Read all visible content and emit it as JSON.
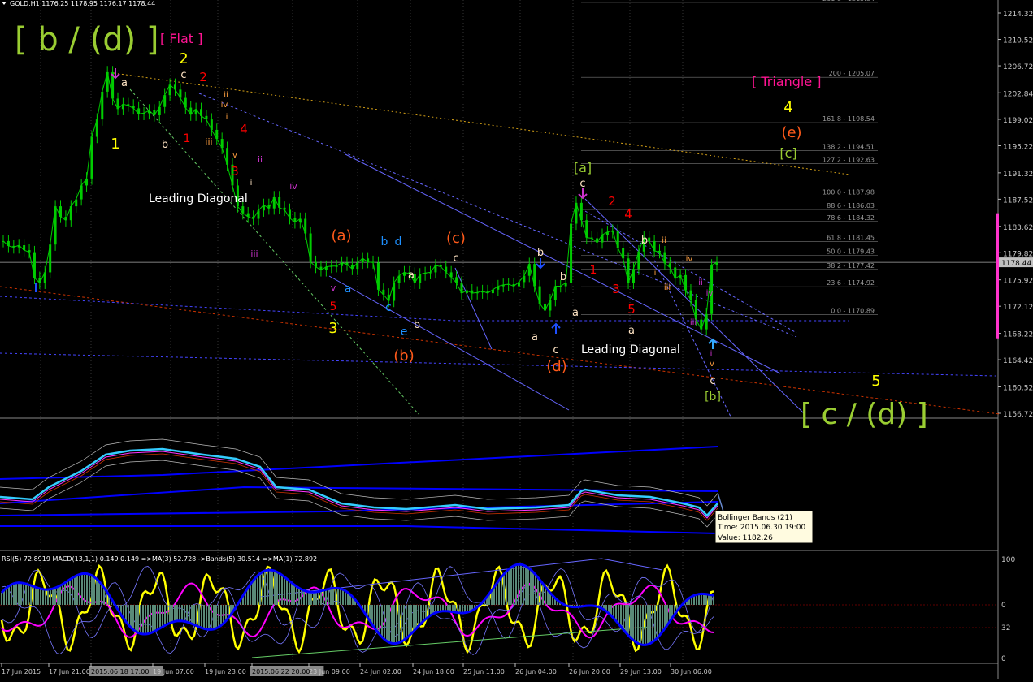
{
  "window": {
    "title": "GOLD,H1",
    "ohlc": [
      "1176.25",
      "1178.95",
      "1176.17",
      "1178.44"
    ]
  },
  "colors": {
    "background": "#000000",
    "candle": "#00cc00",
    "grid": "#2a2a2a",
    "axis_text": "#c8c8c8",
    "wave_yellow": "#ffff00",
    "wave_red": "#ff0000",
    "wave_orange": "#ff5a1a",
    "wave_green": "#9acd32",
    "wave_blue": "#1e90ff",
    "wave_purple": "#cc33cc",
    "wave_pink": "#ff1493",
    "wave_peach": "#ffe4c4",
    "wave_lightorange": "#ff9f40",
    "bb_cyan": "#33ccff",
    "bb_blue": "#0000ff",
    "rsi_yellow": "#ffff00",
    "ma_magenta": "#ff00ff",
    "macd_hist": "#5a8a78",
    "current_price_bg": "#c0c0c0"
  },
  "chart_data": [
    {
      "type": "line",
      "title": "GOLD,H1",
      "series": [
        {
          "values": [
            1181.5,
            1180.8,
            1180.6,
            1180.9,
            1180.2,
            1179.9,
            1176.2,
            1175.5,
            1177.0,
            1181.0,
            1186.5,
            1185.0,
            1184.5,
            1186.5,
            1187.5,
            1189.5,
            1190.5,
            1196.5,
            1199.0,
            1203.0,
            1205.8,
            1202.0,
            1200.5,
            1201.2,
            1201.0,
            1200.6,
            1199.8,
            1199.9,
            1200.3,
            1199.6,
            1200.8,
            1202.5,
            1204.0,
            1203.3,
            1202.1,
            1200.7,
            1199.7,
            1200.5,
            1199.5,
            1199.0,
            1197.5,
            1196.2,
            1194.9,
            1192.5,
            1189.5,
            1186.5,
            1185.5,
            1185.0,
            1184.7,
            1185.9,
            1186.7,
            1186.2,
            1187.8,
            1186.3,
            1186.0,
            1184.8,
            1184.2,
            1184.7,
            1182.6,
            1178.5,
            1177.8,
            1177.3,
            1177.8,
            1177.9,
            1177.9,
            1178.4,
            1178.1,
            1177.5,
            1178.4,
            1179.0,
            1178.5,
            1178.4,
            1174.5,
            1173.8,
            1172.9,
            1175.5,
            1176.5,
            1177.0,
            1176.8,
            1175.5,
            1176.7,
            1176.9,
            1177.0,
            1178.0,
            1177.8,
            1177.0,
            1176.3,
            1175.5,
            1174.0,
            1174.4,
            1174.0,
            1174.1,
            1174.3,
            1174.0,
            1174.5,
            1175.0,
            1175.2,
            1175.3,
            1175.0,
            1175.6,
            1176.5,
            1178.2,
            1175.0,
            1172.5,
            1171.5,
            1173.0,
            1175.0,
            1175.0,
            1175.5,
            1184.0,
            1187.0,
            1184.5,
            1182.0,
            1181.9,
            1181.3,
            1182.4,
            1182.8,
            1183.0,
            1180.5,
            1179.0,
            1175.5,
            1177.5,
            1180.0,
            1182.0,
            1181.5,
            1180.1,
            1179.9,
            1178.3,
            1177.7,
            1176.1,
            1176.6,
            1174.4,
            1173.0,
            1170.2,
            1168.8,
            1171.0,
            1178.0,
            1178.44
          ]
        }
      ],
      "x_tick_labels": [
        "17 Jun 2015",
        "17 Jun 21:00",
        "2015.06.18 17:00",
        "19 Jun 07:00",
        "19 Jun 23:00",
        "2015.06.22 20:00",
        "23 Jun 09:00",
        "24 Jun 02:00",
        "24 Jun 18:00",
        "25 Jun 11:00",
        "26 Jun 04:00",
        "26 Jun 20:00",
        "29 Jun 13:00",
        "30 Jun 06:00"
      ],
      "y_tick_labels": [
        "1214.32",
        "1210.52",
        "1206.72",
        "1202.84",
        "1199.02",
        "1195.22",
        "1191.32",
        "1187.52",
        "1183.62",
        "1179.82",
        "1175.92",
        "1172.12",
        "1168.22",
        "1164.42",
        "1160.52",
        "1156.72"
      ],
      "ylim": [
        1156.72,
        1214.32
      ],
      "current_price": "1178.44",
      "fibonacci_levels": [
        "261.8 - 1215.84",
        "200 - 1205.07",
        "161.8 - 1198.54",
        "138.2 - 1194.51",
        "127.2 - 1192.63",
        "100.0 - 1187.98",
        "88.6 - 1186.03",
        "78.6 - 1184.32",
        "61.8 - 1181.45",
        "50.0 - 1179.43",
        "38.2 - 1177.42",
        "23.6 - 1174.92",
        "0.0 - 1170.89"
      ],
      "wave_labels": {
        "big_label": "[ b / (d) ]",
        "flat_label": "[ Flat ]",
        "triangle_label": "[ Triangle ]",
        "c_d_label": "[ c / (d) ]",
        "leading_diagonal_1": "Leading Diagonal",
        "leading_diagonal_2": "Leading Diagonal",
        "labels": [
          {
            "text": "1",
            "color": "wave_yellow"
          },
          {
            "text": "2",
            "color": "wave_yellow"
          },
          {
            "text": "3",
            "color": "wave_yellow"
          },
          {
            "text": "4",
            "color": "wave_yellow"
          },
          {
            "text": "5",
            "color": "wave_yellow"
          },
          {
            "text": "a",
            "color": "wave_peach"
          },
          {
            "text": "c",
            "color": "wave_peach"
          },
          {
            "text": "b",
            "color": "wave_peach"
          },
          {
            "text": "2",
            "color": "wave_red"
          },
          {
            "text": "1",
            "color": "wave_red"
          },
          {
            "text": "3",
            "color": "wave_red"
          },
          {
            "text": "4",
            "color": "wave_red"
          },
          {
            "text": "5",
            "color": "wave_red"
          },
          {
            "text": "ii",
            "color": "wave_lightorange"
          },
          {
            "text": "iii",
            "color": "wave_lightorange"
          },
          {
            "text": "iv",
            "color": "wave_lightorange"
          },
          {
            "text": "v",
            "color": "wave_lightorange"
          },
          {
            "text": "i",
            "color": "wave_lightorange"
          },
          {
            "text": "ii",
            "color": "wave_purple"
          },
          {
            "text": "iv",
            "color": "wave_purple"
          },
          {
            "text": "iii",
            "color": "wave_purple"
          },
          {
            "text": "v",
            "color": "wave_purple"
          },
          {
            "text": "i",
            "color": "wave_peach"
          },
          {
            "text": "(a)",
            "color": "wave_orange"
          },
          {
            "text": "(b)",
            "color": "wave_orange"
          },
          {
            "text": "(c)",
            "color": "wave_orange"
          },
          {
            "text": "(d)",
            "color": "wave_orange"
          },
          {
            "text": "(e)",
            "color": "wave_orange"
          },
          {
            "text": "a",
            "color": "wave_blue"
          },
          {
            "text": "b",
            "color": "wave_blue"
          },
          {
            "text": "c",
            "color": "wave_blue"
          },
          {
            "text": "d",
            "color": "wave_blue"
          },
          {
            "text": "e",
            "color": "wave_blue"
          },
          {
            "text": "a",
            "color": "wave_peach"
          },
          {
            "text": "b",
            "color": "wave_peach"
          },
          {
            "text": "c",
            "color": "wave_peach"
          },
          {
            "text": "a",
            "color": "wave_peach"
          },
          {
            "text": "b",
            "color": "wave_peach"
          },
          {
            "text": "c",
            "color": "wave_peach"
          },
          {
            "text": "b",
            "color": "wave_peach"
          },
          {
            "text": "a",
            "color": "wave_peach"
          },
          {
            "text": "[a]",
            "color": "wave_green"
          },
          {
            "text": "c",
            "color": "wave_peach"
          },
          {
            "text": "[b]",
            "color": "wave_green"
          },
          {
            "text": "c",
            "color": "wave_peach"
          },
          {
            "text": "[c]",
            "color": "wave_green"
          },
          {
            "text": "b",
            "color": "wave_peach"
          },
          {
            "text": "a",
            "color": "wave_peach"
          },
          {
            "text": "1",
            "color": "wave_red"
          },
          {
            "text": "2",
            "color": "wave_red"
          },
          {
            "text": "3",
            "color": "wave_red"
          },
          {
            "text": "4",
            "color": "wave_red"
          },
          {
            "text": "5",
            "color": "wave_red"
          },
          {
            "text": "ii",
            "color": "wave_lightorange"
          },
          {
            "text": "i",
            "color": "wave_lightorange"
          },
          {
            "text": "iii",
            "color": "wave_lightorange"
          },
          {
            "text": "iv",
            "color": "wave_lightorange"
          },
          {
            "text": "ii",
            "color": "wave_purple"
          },
          {
            "text": "iv",
            "color": "wave_purple"
          },
          {
            "text": "iii",
            "color": "wave_purple"
          },
          {
            "text": "v",
            "color": "wave_lightorange"
          },
          {
            "text": "i",
            "color": "wave_purple"
          }
        ]
      }
    },
    {
      "type": "line",
      "title": "Bollinger Bands (21)",
      "tooltip": {
        "name": "Bollinger Bands (21)",
        "time": "Time: 2015.06.30 19:00",
        "value": "Value: 1182.26"
      }
    },
    {
      "type": "line",
      "title": "RSI(5) 72.8919 MACD(13,1,1) 0.149 0.149 =>MA(3) 52.728 ->Bands(5) 30.514 =>MA(1) 72.892",
      "y_tick_labels": [
        "100",
        "0",
        "32",
        "0"
      ],
      "ylim": [
        0,
        100
      ]
    }
  ]
}
